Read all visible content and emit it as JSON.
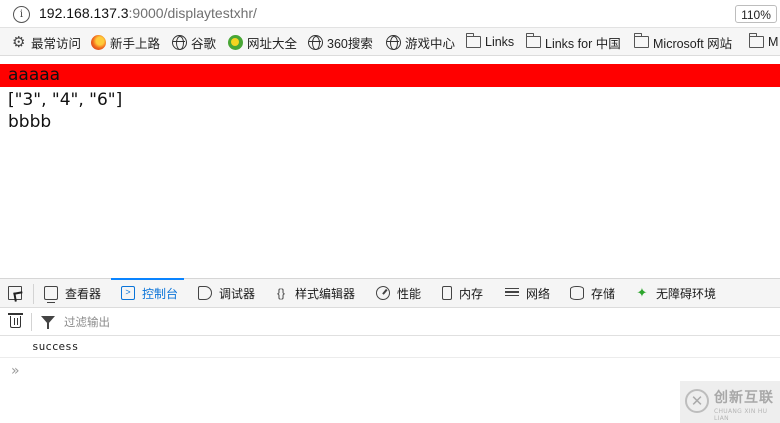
{
  "browser": {
    "url_host": "192.168.137.3",
    "url_rest": ":9000/displaytestxhr/",
    "zoom": "110%"
  },
  "bookmarks": [
    {
      "label": "最常访问",
      "icon": "gear-icon"
    },
    {
      "label": "新手上路",
      "icon": "firefox-icon"
    },
    {
      "label": "谷歌",
      "icon": "globe-icon"
    },
    {
      "label": "网址大全",
      "icon": "daohang-icon"
    },
    {
      "label": "360搜索",
      "icon": "globe-icon"
    },
    {
      "label": "游戏中心",
      "icon": "globe-icon"
    },
    {
      "label": "Links",
      "icon": "folder-icon"
    },
    {
      "label": "Links for 中国",
      "icon": "folder-icon"
    },
    {
      "label": "Microsoft 网站",
      "icon": "folder-icon"
    },
    {
      "label": "M",
      "icon": "folder-icon"
    }
  ],
  "page": {
    "line1": "aaaaa",
    "line2": "[\"3\", \"4\", \"6\"]",
    "line3": "bbbb",
    "highlight_color": "#ff0000"
  },
  "devtools": {
    "tabs": [
      {
        "label": "查看器",
        "icon": "inspector-icon"
      },
      {
        "label": "控制台",
        "icon": "console-icon",
        "active": true
      },
      {
        "label": "调试器",
        "icon": "debugger-icon"
      },
      {
        "label": "样式编辑器",
        "icon": "braces-icon"
      },
      {
        "label": "性能",
        "icon": "performance-icon"
      },
      {
        "label": "内存",
        "icon": "memory-icon"
      },
      {
        "label": "网络",
        "icon": "network-icon"
      },
      {
        "label": "存储",
        "icon": "storage-icon"
      },
      {
        "label": "无障碍环境",
        "icon": "accessibility-icon"
      }
    ],
    "filter_placeholder": "过滤输出",
    "console_messages": [
      "success"
    ],
    "accent_color": "#0a84ff"
  },
  "watermark": {
    "brand_cn": "创新互联",
    "brand_en": "CHUANG XIN HU LIAN"
  }
}
